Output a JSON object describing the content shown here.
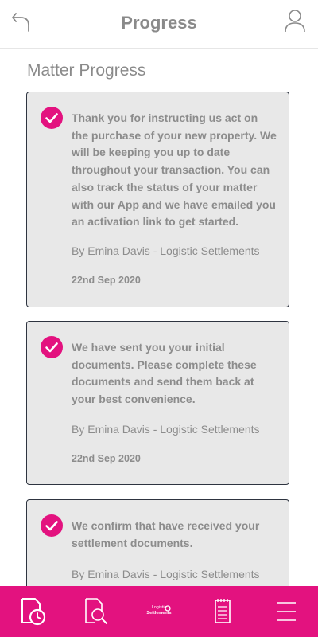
{
  "header": {
    "title": "Progress",
    "back_icon": "back-arrow-icon",
    "user_icon": "user-icon"
  },
  "section_title": "Matter Progress",
  "colors": {
    "accent": "#e3127f",
    "text": "#8a8a8a",
    "card_bg": "#e8e8e8",
    "card_border": "#2e3440"
  },
  "updates": [
    {
      "message": "Thank you for instructing us act on the purchase of your new property. We will be keeping you up to date throughout your transaction. You can also track the status of your matter with our App and we have emailed you an activation link to get started.",
      "author": "By Emina Davis - Logistic Settlements",
      "date": "22nd Sep 2020"
    },
    {
      "message": "We have sent you your initial documents. Please complete these documents and send them back at your best convenience.",
      "author": "By Emina Davis - Logistic Settlements",
      "date": "22nd Sep 2020"
    },
    {
      "message": "We confirm that have received your settlement documents.",
      "author": "By Emina Davis - Logistic Settlements",
      "date": ""
    }
  ],
  "tabbar": {
    "items": [
      {
        "icon": "progress-clock-icon"
      },
      {
        "icon": "document-search-icon"
      },
      {
        "icon": "logo-icon",
        "logo_line1": "Logistic",
        "logo_line2": "Settlements"
      },
      {
        "icon": "notepad-icon"
      },
      {
        "icon": "menu-icon"
      }
    ]
  }
}
